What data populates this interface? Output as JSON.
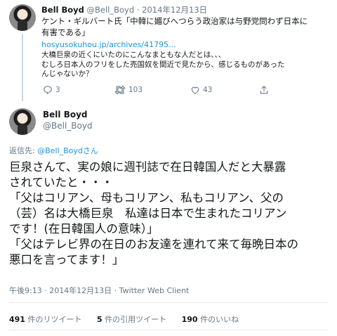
{
  "parent_tweet": {
    "name": "Bell Boyd",
    "handle": "@Bell_Boyd",
    "separator": "·",
    "date": "2014年12月13日",
    "text_lines": [
      "ケント・ギルバート氏「中韓に媚びへつらう政治家は与野党問わず日本に",
      "有害である」"
    ],
    "link": "hosyusokuhou.jp/archives/41795...",
    "body_lines": [
      "大橋巨泉の近くにいたのにこんなまともな人だとは、、、",
      "むしろ日本人のフリをした売国奴を間近で見たから、感じるものがあった",
      "んじゃないか？"
    ],
    "reply_count": "3",
    "retweet_count": "103",
    "like_count": "43"
  },
  "main_tweet": {
    "name": "Bell Boyd",
    "handle": "@Bell_Boyd",
    "reply_prefix": "返信先: ",
    "reply_to": "@Bell_Boydさん",
    "text_lines": [
      "巨泉さんて、実の娘に週刊誌で在日韓国人だと大暴露",
      "されていたと・・・",
      "「父はコリアン、母もコリアン、私もコリアン、父の",
      "（芸）名は大橋巨泉　私達は日本で生まれたコリアン",
      "です！(在日韓国人の意味）」",
      "「父はテレビ界の在日のお友達を連れて来て毎晩日本の",
      "悪口を言ってます！」"
    ],
    "meta": "午後9:13 · 2014年12月13日 · Twitter Web Client"
  },
  "stats": {
    "retweets_count": "491",
    "retweets_label": " 件のリツイート",
    "quotes_count": "5",
    "quotes_label": " 件の引用ツイート",
    "likes_count": "190",
    "likes_label": " 件のいいね"
  },
  "icons": {
    "reply": "reply-icon",
    "retweet": "retweet-icon",
    "like": "heart-icon",
    "share": "share-icon",
    "avatar": "avatar"
  },
  "colors": {
    "link": "#1b95e0",
    "muted": "#657786",
    "text": "#14171a",
    "divider": "#e6ecf0"
  }
}
